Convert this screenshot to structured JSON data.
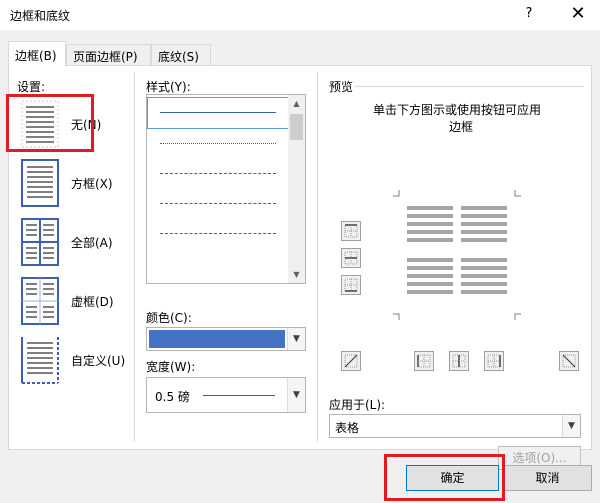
{
  "window": {
    "title": "边框和底纹",
    "help": "?",
    "close": "✕"
  },
  "tabs": [
    {
      "label": "边框(B)",
      "active": true
    },
    {
      "label": "页面边框(P)",
      "active": false
    },
    {
      "label": "底纹(S)",
      "active": false
    }
  ],
  "settings": {
    "heading": "设置:",
    "items": [
      {
        "label": "无(N)",
        "icon": "setting-none-icon",
        "selected": true
      },
      {
        "label": "方框(X)",
        "icon": "setting-box-icon"
      },
      {
        "label": "全部(A)",
        "icon": "setting-all-icon"
      },
      {
        "label": "虚框(D)",
        "icon": "setting-grid-icon"
      },
      {
        "label": "自定义(U)",
        "icon": "setting-custom-icon"
      }
    ]
  },
  "style": {
    "heading": "样式(Y):",
    "rows": [
      "solid",
      "dotted",
      "dash-dot",
      "dashed",
      "long-dash"
    ]
  },
  "color": {
    "heading": "颜色(C):",
    "value": "#4472c4"
  },
  "width": {
    "heading": "宽度(W):",
    "value": "0.5 磅"
  },
  "preview": {
    "heading": "预览",
    "hint_line1": "单击下方图示或使用按钮可应用",
    "hint_line2": "边框"
  },
  "apply_to": {
    "heading": "应用于(L):",
    "value": "表格"
  },
  "options_button": "选项(O)...",
  "ok_button": "确定",
  "cancel_button": "取消",
  "colors": {
    "accent": "#4472c4",
    "highlight": "#e01b24",
    "focus": "#0078d7"
  }
}
